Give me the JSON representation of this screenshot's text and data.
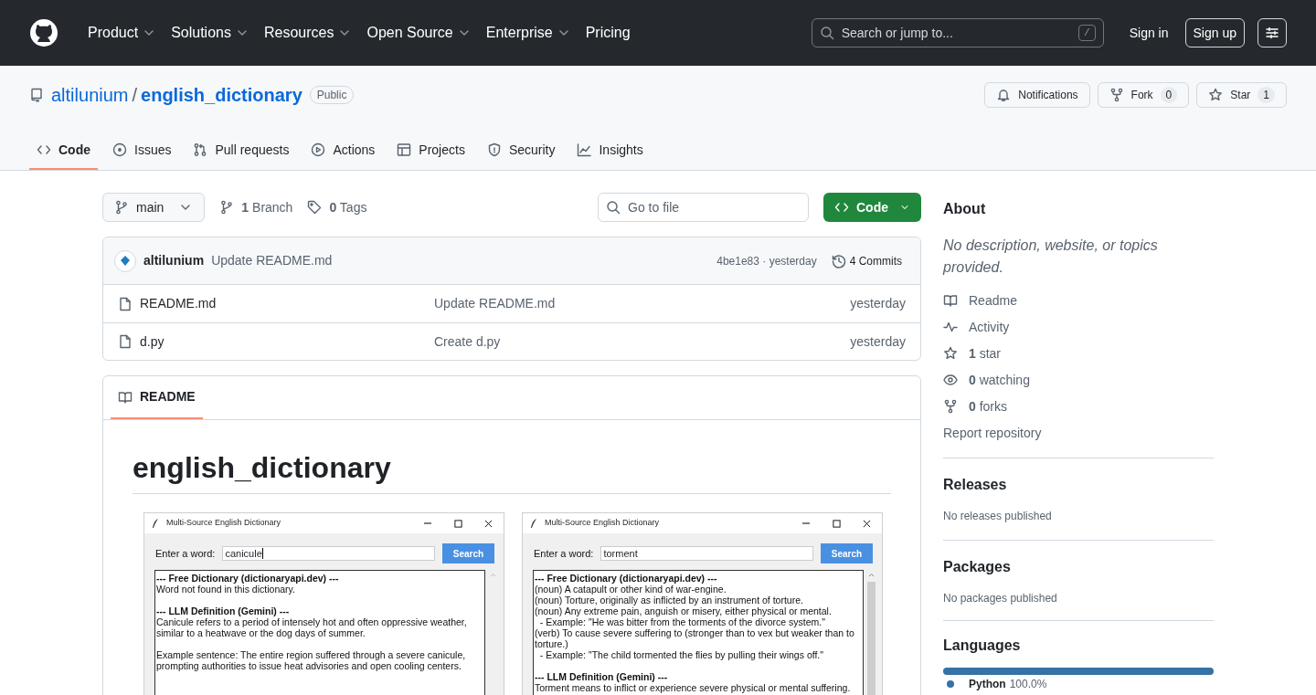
{
  "header": {
    "nav": [
      {
        "label": "Product",
        "dropdown": true
      },
      {
        "label": "Solutions",
        "dropdown": true
      },
      {
        "label": "Resources",
        "dropdown": true
      },
      {
        "label": "Open Source",
        "dropdown": true
      },
      {
        "label": "Enterprise",
        "dropdown": true
      },
      {
        "label": "Pricing",
        "dropdown": false
      }
    ],
    "search": {
      "placeholder": "Search or jump to...",
      "shortcut": "/"
    },
    "sign_in": "Sign in",
    "sign_up": "Sign up"
  },
  "repo": {
    "owner": "altilunium",
    "separator": "/",
    "name": "english_dictionary",
    "visibility": "Public",
    "actions": [
      {
        "kind": "bell",
        "label": "Notifications"
      },
      {
        "kind": "fork",
        "label": "Fork",
        "count": "0"
      },
      {
        "kind": "star",
        "label": "Star",
        "count": "1"
      }
    ]
  },
  "tabs": [
    {
      "kind": "code",
      "label": "Code",
      "selected": true
    },
    {
      "kind": "issue",
      "label": "Issues",
      "selected": false
    },
    {
      "kind": "pr",
      "label": "Pull requests",
      "selected": false
    },
    {
      "kind": "play",
      "label": "Actions",
      "selected": false
    },
    {
      "kind": "table",
      "label": "Projects",
      "selected": false
    },
    {
      "kind": "shield",
      "label": "Security",
      "selected": false
    },
    {
      "kind": "graph",
      "label": "Insights",
      "selected": false
    }
  ],
  "branch_bar": {
    "branch": "main",
    "branches": "**1** Branch",
    "tags": "**0** Tags",
    "go_to_file": "Go to file",
    "code_button": "Code"
  },
  "latest_commit": {
    "author": "altilunium",
    "message": "Update README.md",
    "meta": "4be1e83 · yesterday",
    "commits": "4 Commits"
  },
  "files": [
    {
      "name": "README.md",
      "commit": "Update README.md",
      "time": "yesterday"
    },
    {
      "name": "d.py",
      "commit": "Create d.py",
      "time": "yesterday"
    }
  ],
  "readme": {
    "tab": "README",
    "heading": "english_dictionary",
    "screenshots": [
      {
        "title": "Multi-Source English Dictionary",
        "label": "Enter a word:",
        "value": "canicule",
        "focused": true,
        "button": "Search",
        "scrollbar": false,
        "output": [
          {
            "kind": "heading",
            "text": "--- Free Dictionary (dictionaryapi.dev) ---"
          },
          {
            "kind": "line",
            "text": "Word not found in this dictionary."
          },
          {
            "kind": "gap"
          },
          {
            "kind": "heading",
            "text": "--- LLM Definition (Gemini) ---"
          },
          {
            "kind": "line",
            "text": "Canicule refers to a period of intensely hot and often oppressive weather, similar to a heatwave or the dog days of summer."
          },
          {
            "kind": "gap"
          },
          {
            "kind": "line",
            "text": "Example sentence: The entire region suffered through a severe canicule, prompting authorities to issue heat advisories and open cooling centers."
          }
        ]
      },
      {
        "title": "Multi-Source English Dictionary",
        "label": "Enter a word:",
        "value": "torment",
        "focused": false,
        "button": "Search",
        "scrollbar": true,
        "output": [
          {
            "kind": "heading",
            "text": "--- Free Dictionary (dictionaryapi.dev) ---"
          },
          {
            "kind": "line",
            "text": "(noun) A catapult or other kind of war-engine."
          },
          {
            "kind": "line",
            "text": "(noun) Torture, originally as inflicted by an instrument of torture."
          },
          {
            "kind": "line",
            "text": "(noun) Any extreme pain, anguish or misery, either physical or mental."
          },
          {
            "kind": "line",
            "text": "  - Example: \"He was bitter from the torments of the divorce system.\""
          },
          {
            "kind": "line",
            "text": "(verb) To cause severe suffering to (stronger than to vex but weaker than to torture.)"
          },
          {
            "kind": "line",
            "text": "  - Example: \"The child tormented the flies by pulling their wings off.\""
          },
          {
            "kind": "gap"
          },
          {
            "kind": "heading",
            "text": "--- LLM Definition (Gemini) ---"
          },
          {
            "kind": "line",
            "text": "Torment means to inflict or experience severe physical or mental suffering."
          }
        ]
      }
    ]
  },
  "about": {
    "title": "About",
    "description": "No description, website, or topics provided.",
    "links": [
      {
        "kind": "book",
        "text": "Readme"
      },
      {
        "kind": "pulse",
        "text": "Activity"
      },
      {
        "kind": "star",
        "text": "**1** star"
      },
      {
        "kind": "eye",
        "text": "**0** watching"
      },
      {
        "kind": "fork",
        "text": "**0** forks"
      }
    ],
    "report": "Report repository"
  },
  "releases": {
    "title": "Releases",
    "text": "No releases published"
  },
  "packages": {
    "title": "Packages",
    "text": "No packages published"
  },
  "languages": {
    "title": "Languages",
    "items": [
      {
        "name": "Python",
        "percent": "100.0%",
        "color": "#3572a5",
        "level": 1
      }
    ]
  }
}
